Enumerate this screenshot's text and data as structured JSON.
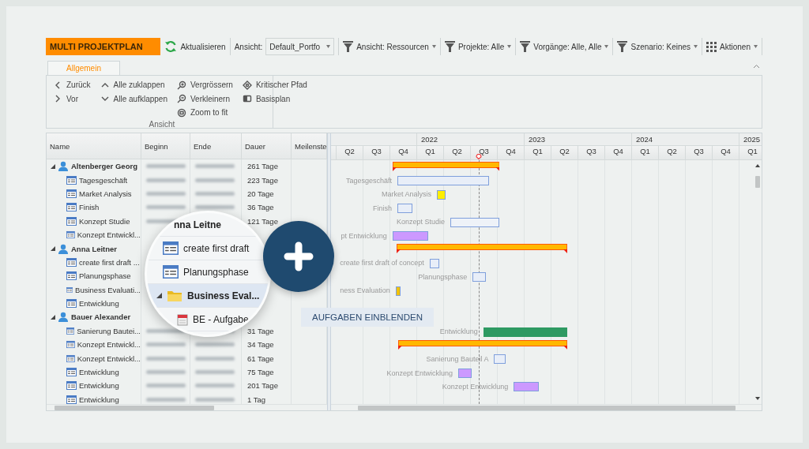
{
  "toolbar": {
    "title": "MULTI PROJEKTPLAN",
    "items": [
      {
        "kind": "refresh",
        "label": "Aktualisieren"
      },
      {
        "kind": "select",
        "label": "Ansicht:",
        "value": "Default_Portfo"
      },
      {
        "kind": "filter",
        "label": "Ansicht: Ressourcen"
      },
      {
        "kind": "filter",
        "label": "Projekte: Alle"
      },
      {
        "kind": "filter",
        "label": "Vorgänge: Alle, Alle"
      },
      {
        "kind": "filter",
        "label": "Szenario: Keines"
      },
      {
        "kind": "menu",
        "label": "Aktionen"
      }
    ]
  },
  "ribbon": {
    "tabs": [
      {
        "label": "Allgemein",
        "selected": true
      }
    ],
    "group": {
      "label": "Ansicht",
      "columns": [
        [
          "Zurück",
          "Vor"
        ],
        [
          "Alle zuklappen",
          "Alle aufklappen"
        ],
        [
          "Vergrössern",
          "Verkleinern",
          "Zoom to fit"
        ],
        [
          "Kritischer Pfad",
          "Basisplan"
        ]
      ]
    }
  },
  "table": {
    "columns": [
      "Name",
      "Beginn",
      "Ende",
      "Dauer",
      "Meilenste"
    ],
    "rows": [
      {
        "name": "Altenberger Georg",
        "kind": "resource",
        "expanded": true,
        "dates_blurred": true,
        "duration": "261 Tage",
        "children": [
          {
            "name": "Tagesgeschäft",
            "kind": "task",
            "dates_blurred": true,
            "duration": "223 Tage"
          },
          {
            "name": "Market Analysis",
            "kind": "task",
            "dates_blurred": true,
            "duration": "20 Tage"
          },
          {
            "name": "Finish",
            "kind": "task",
            "dates_blurred": true,
            "duration": "36 Tage"
          },
          {
            "name": "Konzept Studie",
            "kind": "task",
            "dates_blurred": true,
            "duration": "121 Tage"
          },
          {
            "name": "Konzept Entwickl...",
            "kind": "task",
            "dates_blurred": false
          }
        ]
      },
      {
        "name": "Anna Leitner",
        "kind": "resource",
        "expanded": true,
        "dates_blurred": false,
        "children": [
          {
            "name": "create first draft ...",
            "kind": "task",
            "dates_blurred": false
          },
          {
            "name": "Planungsphase",
            "kind": "task",
            "dates_blurred": false
          },
          {
            "name": "Business Evaluati...",
            "kind": "task",
            "dates_blurred": false
          },
          {
            "name": "Entwicklung",
            "kind": "task",
            "dates_blurred": false
          }
        ]
      },
      {
        "name": "Bauer Alexander",
        "kind": "resource",
        "expanded": true,
        "dates_blurred": false,
        "children": [
          {
            "name": "Sanierung Bautei...",
            "kind": "task",
            "dates_blurred": true,
            "duration": "31 Tage"
          },
          {
            "name": "Konzept Entwickl...",
            "kind": "task",
            "dates_blurred": true,
            "duration": "34 Tage"
          },
          {
            "name": "Konzept Entwickl...",
            "kind": "task",
            "dates_blurred": true,
            "duration": "61 Tage"
          },
          {
            "name": "Entwicklung",
            "kind": "task",
            "dates_blurred": true,
            "duration": "75 Tage"
          },
          {
            "name": "Entwicklung",
            "kind": "task",
            "dates_blurred": true,
            "duration": "201 Tage"
          },
          {
            "name": "Entwicklung",
            "kind": "task",
            "dates_blurred": true,
            "duration": "1 Tag"
          }
        ]
      }
    ]
  },
  "timeline": {
    "years": [
      "2022",
      "2023",
      "2024",
      "2025"
    ],
    "quarters": [
      "Q2",
      "Q3",
      "Q4",
      "Q1",
      "Q2",
      "Q3",
      "Q4",
      "Q1",
      "Q2",
      "Q3",
      "Q4",
      "Q1",
      "Q2",
      "Q3",
      "Q4",
      "Q1"
    ],
    "rows": [
      {
        "kind": "summary"
      },
      {
        "kind": "task",
        "label": "Tagesgeschäft",
        "color": "#e8eef8"
      },
      {
        "kind": "task",
        "label": "Market Analysis",
        "color": "#ffee00"
      },
      {
        "kind": "task",
        "label": "Finish",
        "color": "#e8eef8"
      },
      {
        "kind": "task",
        "label": "Konzept Studie",
        "color": "#eef2f8"
      },
      {
        "kind": "task",
        "label": "pt Entwicklung",
        "color": "#cc99ff"
      },
      {
        "kind": "summary"
      },
      {
        "kind": "task",
        "label": "create first draft of concept",
        "color": "#e8eef8"
      },
      {
        "kind": "task",
        "label": "Planungsphase",
        "color": "#e8eef8"
      },
      {
        "kind": "task",
        "label": "ness Evaluation",
        "color": "#f2c200"
      },
      {
        "kind": "empty"
      },
      {
        "kind": "empty"
      },
      {
        "kind": "task",
        "label": "Entwicklung",
        "color": "#2e9a62"
      },
      {
        "kind": "summary"
      },
      {
        "kind": "task",
        "label": "Sanierung Bauteil A",
        "color": "#e8eef8"
      },
      {
        "kind": "task",
        "label": "Konzept Entwicklung",
        "color": "#cc99ff"
      },
      {
        "kind": "task",
        "label": "Konzept Entwicklung",
        "color": "#cc99ff"
      }
    ]
  },
  "magnifier": {
    "rows": [
      {
        "kind": "resource",
        "label": "nna Leitne",
        "selected": false
      },
      {
        "kind": "task",
        "label": "create first draft",
        "selected": false
      },
      {
        "kind": "task",
        "label": "Planungsphase",
        "selected": false
      },
      {
        "kind": "folder",
        "label": "Business Eval...",
        "selected": true,
        "expanded": true
      },
      {
        "kind": "event",
        "label": "BE - Aufgabe",
        "selected": false
      }
    ]
  },
  "promo": {
    "label": "AUFGABEN EINBLENDEN"
  }
}
